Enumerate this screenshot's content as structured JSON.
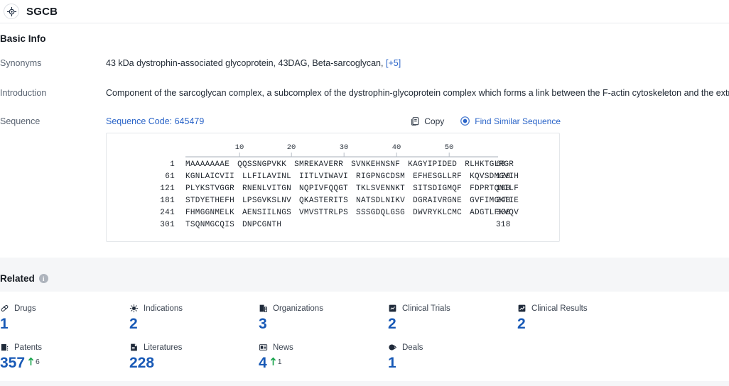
{
  "header": {
    "title": "SGCB",
    "icon": "target-icon"
  },
  "basic_info": {
    "section_title": "Basic Info",
    "rows": [
      {
        "label": "Synonyms"
      },
      {
        "label": "Introduction"
      },
      {
        "label": "Sequence"
      }
    ],
    "synonyms": {
      "value": "43 kDa dystrophin-associated glycoprotein,  43DAG,  Beta-sarcoglycan,",
      "more": "[+5]"
    },
    "introduction": {
      "value": "Component of the sarcoglycan complex, a subcomplex of the dystrophin-glycoprotein complex which forms a link between the F-actin cytoskeleton and the extracellular matrix"
    },
    "sequence": {
      "code_label": "Sequence Code: 645479",
      "copy_label": "Copy",
      "find_similar_label": "Find Similar Sequence",
      "ruler_ticks": [
        "10",
        "20",
        "30",
        "40",
        "50"
      ],
      "lines": [
        {
          "start": "1",
          "chunks": [
            "MAAAAAAAE",
            "QQSSNGPVKK",
            "SMREKAVERR",
            "SVNKEHNSNF",
            "KAGYIPIDED",
            "RLHKTGLRGR"
          ],
          "end": "60"
        },
        {
          "start": "61",
          "chunks": [
            "KGNLAICVII",
            "LLFILAVINL",
            "IITLVIWAVI",
            "RIGPNGCDSM",
            "EFHESGLLRF",
            "KQVSDMGVIH"
          ],
          "end": "120"
        },
        {
          "start": "121",
          "chunks": [
            "PLYKSTVGGR",
            "RNENLVITGN",
            "NQPIVFQQGT",
            "TKLSVENNKT",
            "SITSDIGMQF",
            "FDPRTQNILF"
          ],
          "end": "180"
        },
        {
          "start": "181",
          "chunks": [
            "STDYETHEFH",
            "LPSGVKSLNV",
            "QKASTERITS",
            "NATSDLNIKV",
            "DGRAIVRGNE",
            "GVFIMGKTIE"
          ],
          "end": "240"
        },
        {
          "start": "241",
          "chunks": [
            "FHMGGNMELK",
            "AENSIILNGS",
            "VMVSTTRLPS",
            "SSSGDQLGSG",
            "DWVRYKLCMC",
            "ADGTLFKVQV"
          ],
          "end": "300"
        },
        {
          "start": "301",
          "chunks": [
            "TSQNMGCQIS",
            "DNPCGNTH"
          ],
          "end": "318"
        }
      ]
    }
  },
  "related": {
    "section_title": "Related",
    "info_icon": "info-icon",
    "stats": [
      {
        "icon": "pill-icon",
        "label": "Drugs",
        "value": "1",
        "delta": null
      },
      {
        "icon": "virus-icon",
        "label": "Indications",
        "value": "2",
        "delta": null
      },
      {
        "icon": "building-icon",
        "label": "Organizations",
        "value": "3",
        "delta": null
      },
      {
        "icon": "clipboard-chart-icon",
        "label": "Clinical Trials",
        "value": "2",
        "delta": null
      },
      {
        "icon": "results-chart-icon",
        "label": "Clinical Results",
        "value": "2",
        "delta": null
      },
      {
        "icon": "patent-icon",
        "label": "Patents",
        "value": "357",
        "delta": "6"
      },
      {
        "icon": "literature-icon",
        "label": "Literatures",
        "value": "228",
        "delta": null
      },
      {
        "icon": "news-icon",
        "label": "News",
        "value": "4",
        "delta": "1"
      },
      {
        "icon": "deals-icon",
        "label": "Deals",
        "value": "1",
        "delta": null
      }
    ]
  },
  "colors": {
    "accent_blue": "#1859b6",
    "link_blue": "#2a64c8",
    "delta_green": "#16a34a",
    "label_grey": "#5a6472"
  }
}
